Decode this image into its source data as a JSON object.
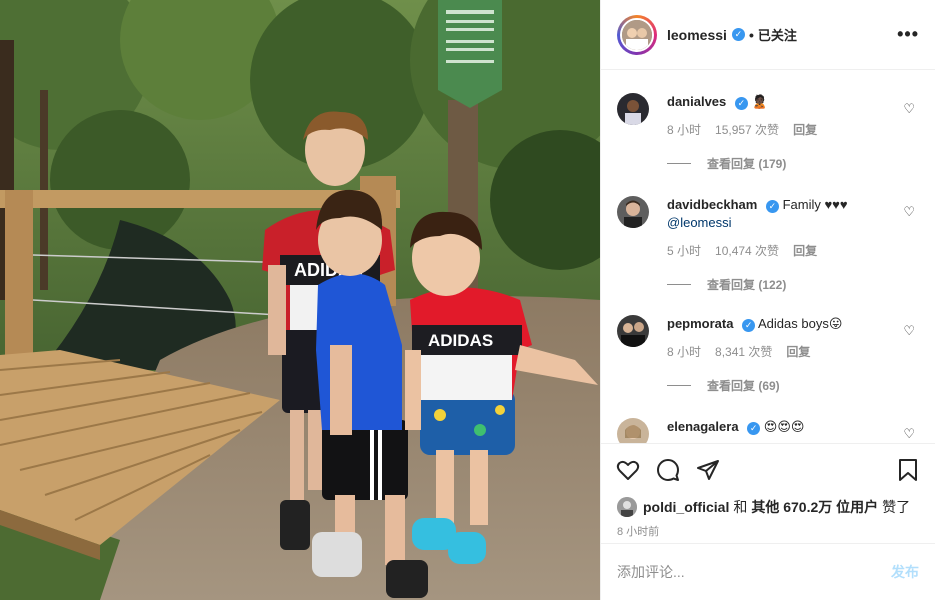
{
  "header": {
    "username": "leomessi",
    "verified_mark": "✓",
    "separator": "•",
    "follow_status": "已关注",
    "more": "•••"
  },
  "comments": [
    {
      "user": "danialves",
      "text": "",
      "emoji": "🙎🏿",
      "time": "8 小时",
      "likes": "15,957 次赞",
      "reply": "回复",
      "view_replies": "查看回复 (179)"
    },
    {
      "user": "davidbeckham",
      "text": "Family ♥♥♥",
      "mention": "@leomessi",
      "time": "5 小时",
      "likes": "10,474 次赞",
      "reply": "回复",
      "view_replies": "查看回复 (122)"
    },
    {
      "user": "pepmorata",
      "text": "Adidas boys😛",
      "time": "8 小时",
      "likes": "8,341 次赞",
      "reply": "回复",
      "view_replies": "查看回复 (69)"
    },
    {
      "user": "elenagalera",
      "text": "😍😍😍"
    }
  ],
  "photo": {
    "shirt_text_1": "ADIDAS",
    "shirt_text_2": "ADIDAS",
    "sign_text": ""
  },
  "likes": {
    "user": "poldi_official",
    "and": "和",
    "others": "其他 670.2万 位用户",
    "liked": "赞了"
  },
  "time_ago": "8 小时前",
  "add_comment": {
    "placeholder": "添加评论...",
    "post_label": "发布"
  },
  "icons": [
    "heart-icon",
    "comment-icon",
    "share-icon",
    "bookmark-icon"
  ],
  "colors": {
    "verified": "#3897f0",
    "post": "#b2dffc",
    "muted": "#8e8e8e"
  }
}
